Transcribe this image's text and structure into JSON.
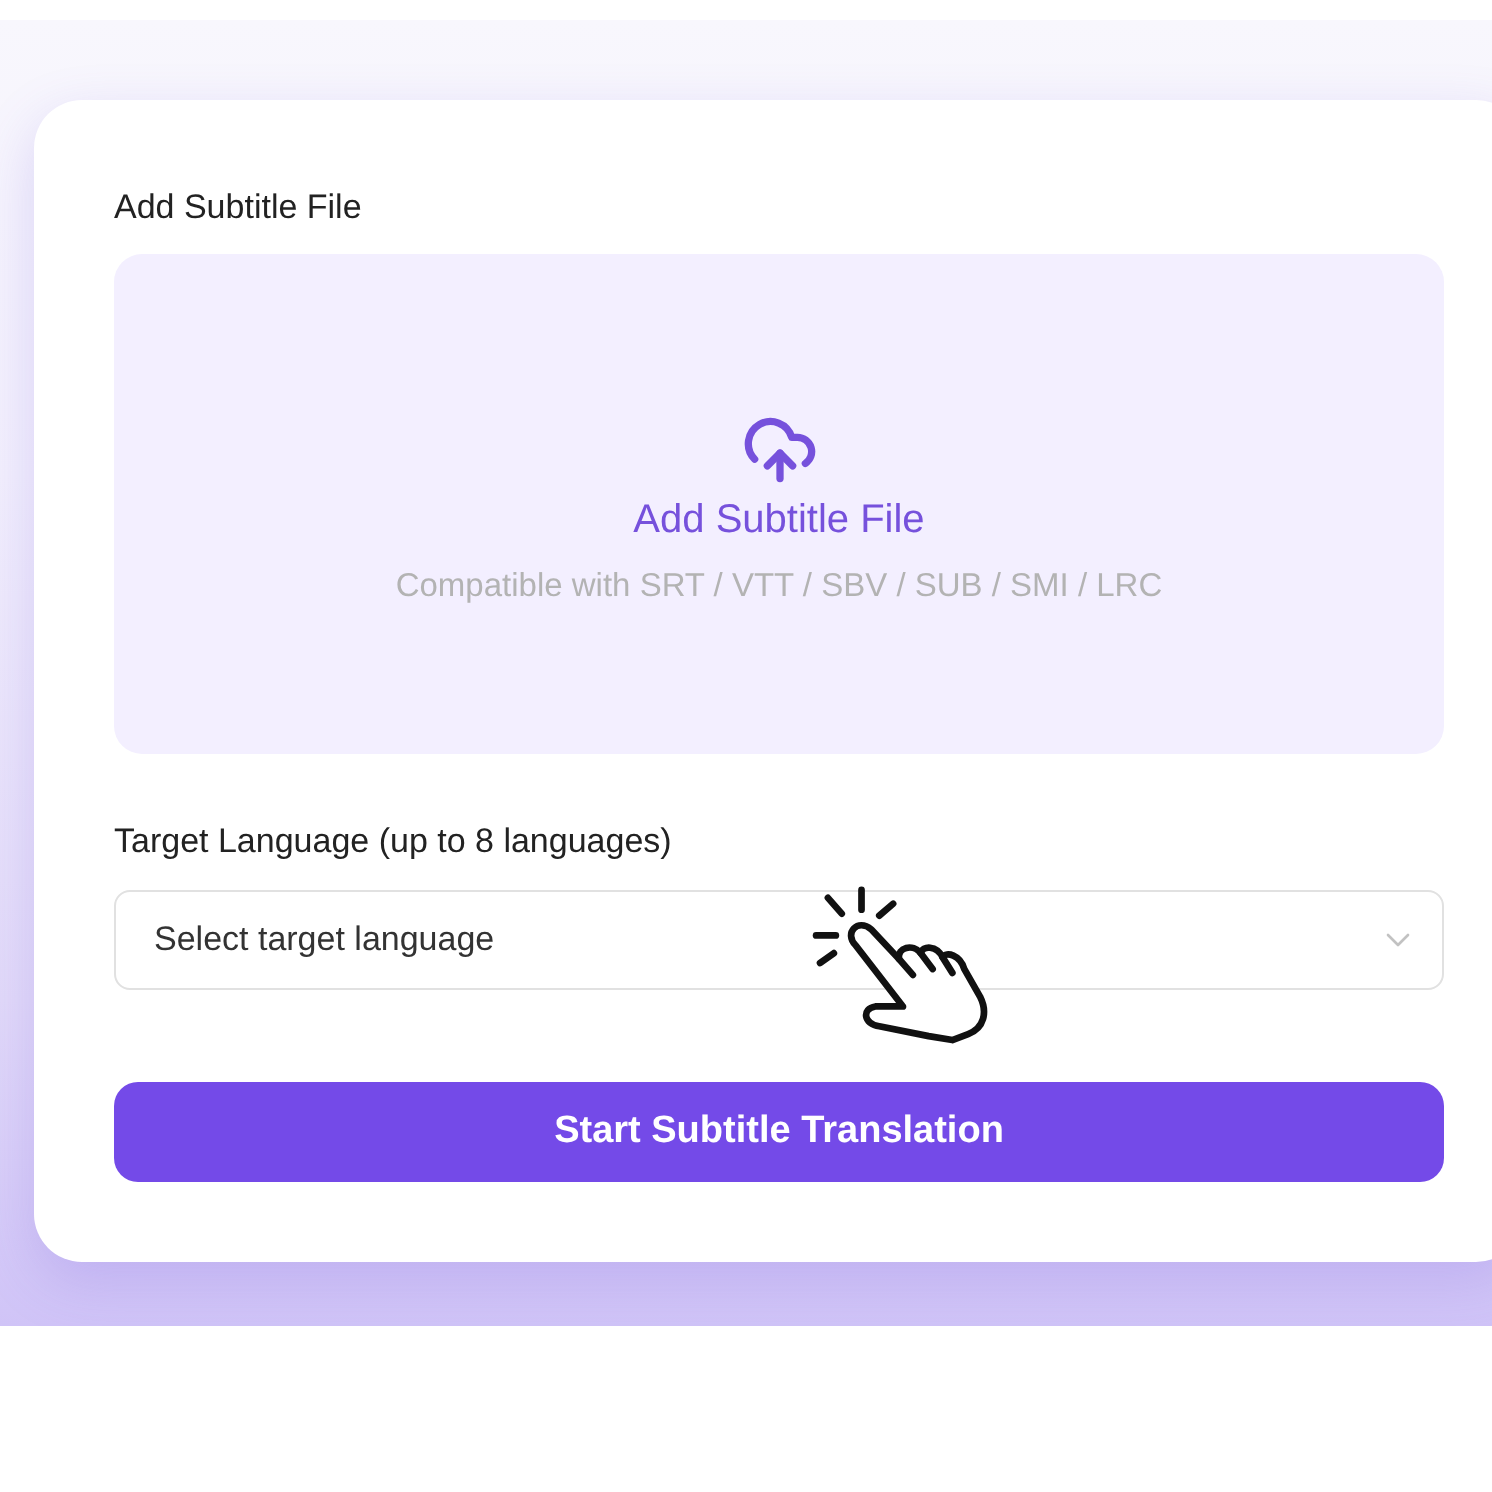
{
  "upload": {
    "label": "Add Subtitle File",
    "dropzone": {
      "title": "Add Subtitle File",
      "formats": "Compatible with SRT / VTT / SBV / SUB / SMI / LRC"
    }
  },
  "language": {
    "label": "Target Language (up to 8 languages)",
    "select": {
      "placeholder": "Select target language"
    }
  },
  "button": {
    "label": "Start Subtitle Translation"
  }
}
